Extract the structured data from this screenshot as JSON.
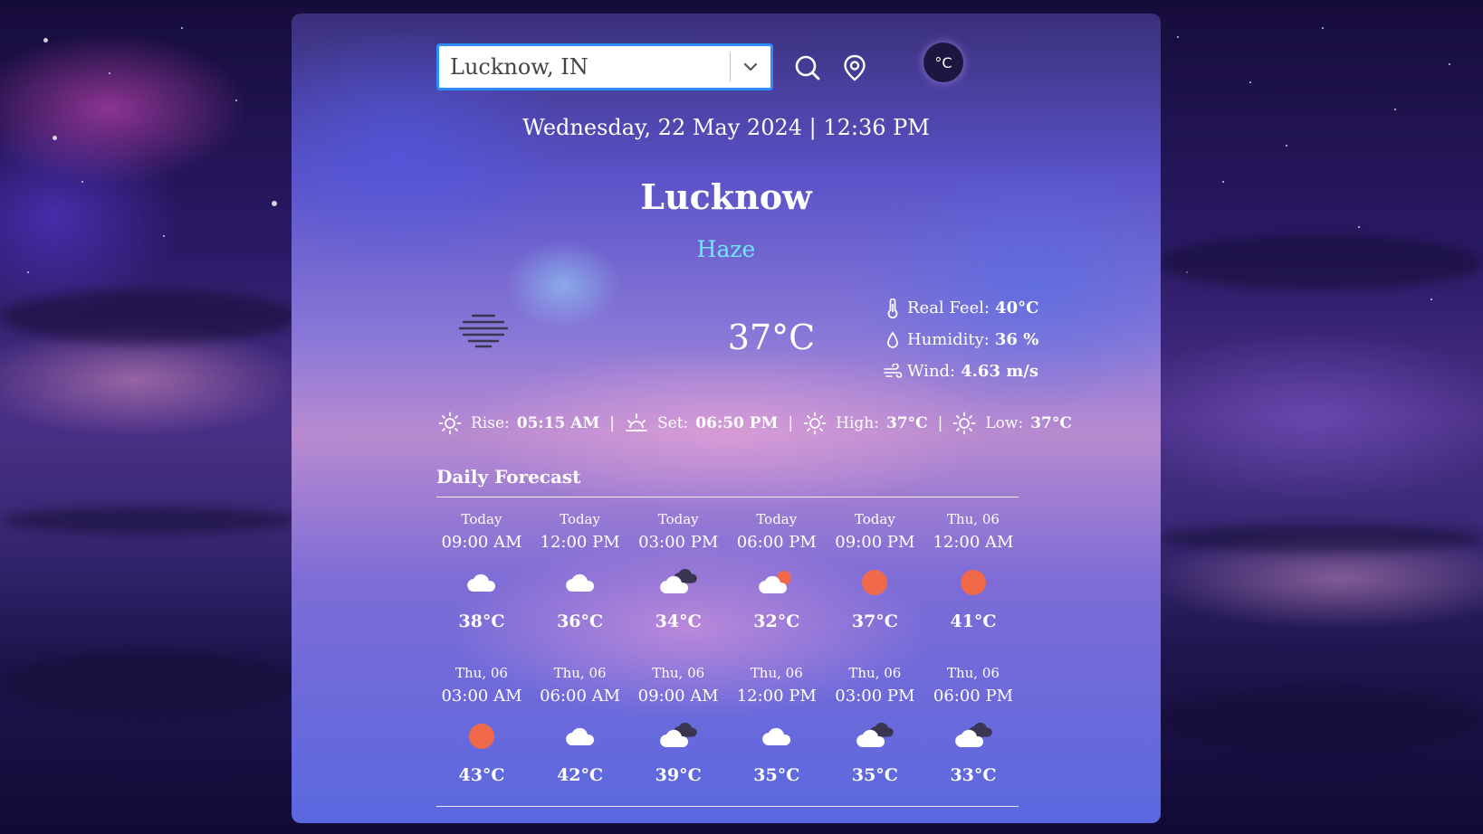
{
  "search": {
    "value": "Lucknow, IN"
  },
  "unit_toggle": {
    "label": "°C"
  },
  "header": {
    "datetime": "Wednesday, 22 May 2024 | 12:36 PM",
    "city": "Lucknow",
    "condition": "Haze"
  },
  "current": {
    "temp": "37°C",
    "icon": "haze-icon",
    "real_feel_label": "Real Feel:",
    "real_feel_value": "40°C",
    "humidity_label": "Humidity:",
    "humidity_value": "36 %",
    "wind_label": "Wind:",
    "wind_value": "4.63 m/s"
  },
  "sun": {
    "rise_label": "Rise:",
    "rise_value": "05:15 AM",
    "set_label": "Set:",
    "set_value": "06:50 PM",
    "high_label": "High:",
    "high_value": "37°C",
    "low_label": "Low:",
    "low_value": "37°C",
    "separator": "|"
  },
  "forecast": {
    "title": "Daily Forecast",
    "rows": [
      [
        {
          "day": "Today",
          "time": "09:00 AM",
          "icon": "cloud",
          "temp": "38°C"
        },
        {
          "day": "Today",
          "time": "12:00 PM",
          "icon": "cloud",
          "temp": "36°C"
        },
        {
          "day": "Today",
          "time": "03:00 PM",
          "icon": "cloud-dark",
          "temp": "34°C"
        },
        {
          "day": "Today",
          "time": "06:00 PM",
          "icon": "cloud-sun",
          "temp": "32°C"
        },
        {
          "day": "Today",
          "time": "09:00 PM",
          "icon": "sun",
          "temp": "37°C"
        },
        {
          "day": "Thu, 06",
          "time": "12:00 AM",
          "icon": "sun",
          "temp": "41°C"
        }
      ],
      [
        {
          "day": "Thu, 06",
          "time": "03:00 AM",
          "icon": "sun",
          "temp": "43°C"
        },
        {
          "day": "Thu, 06",
          "time": "06:00 AM",
          "icon": "cloud",
          "temp": "42°C"
        },
        {
          "day": "Thu, 06",
          "time": "09:00 AM",
          "icon": "cloud-dark",
          "temp": "39°C"
        },
        {
          "day": "Thu, 06",
          "time": "12:00 PM",
          "icon": "cloud",
          "temp": "35°C"
        },
        {
          "day": "Thu, 06",
          "time": "03:00 PM",
          "icon": "cloud-dark",
          "temp": "35°C"
        },
        {
          "day": "Thu, 06",
          "time": "06:00 PM",
          "icon": "cloud-dark",
          "temp": "33°C"
        }
      ]
    ]
  },
  "colors": {
    "accent": "#6ee8ff",
    "sun": "#f06a4a",
    "search_border": "#2d8cff"
  }
}
